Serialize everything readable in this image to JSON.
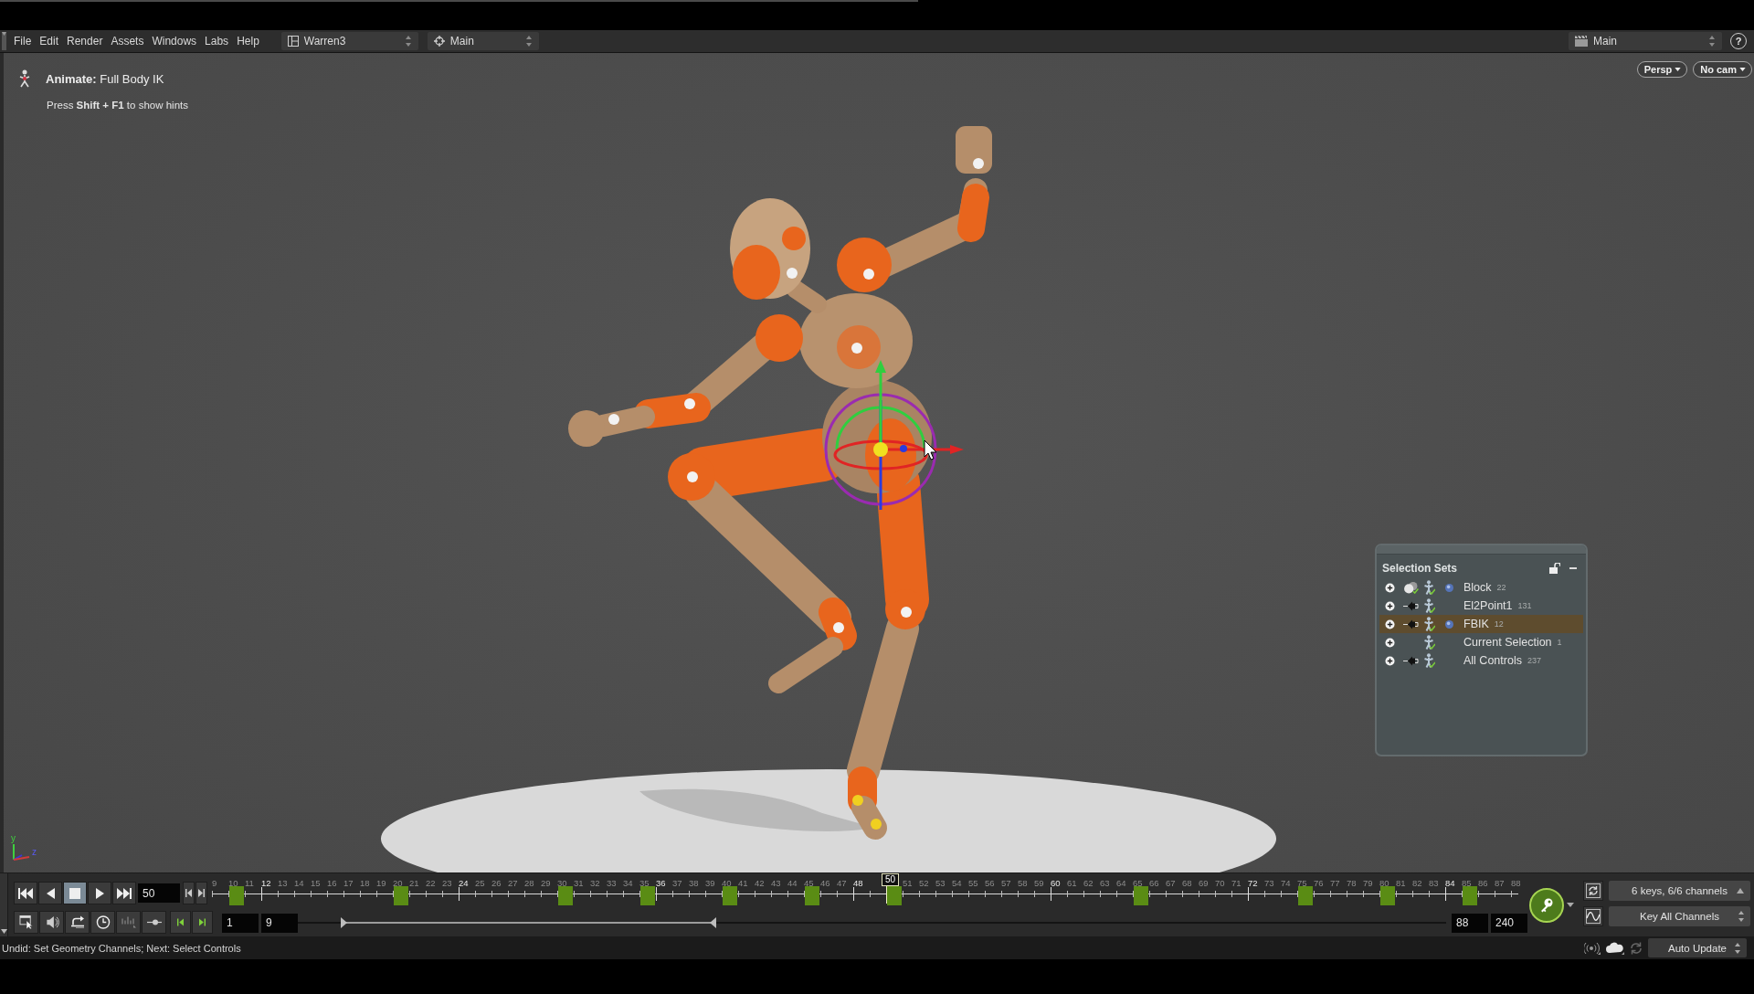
{
  "menubar": {
    "menus": [
      "File",
      "Edit",
      "Render",
      "Assets",
      "Windows",
      "Labs",
      "Help"
    ],
    "selectors": [
      {
        "kind": "layout",
        "label": "Warren3"
      },
      {
        "kind": "context",
        "label": "Main"
      }
    ],
    "take": {
      "label": "Main"
    },
    "help": "?"
  },
  "viewport": {
    "tool_title": "**Animate:** Full Body IK",
    "hint": "Press **Shift + F1** to show hints",
    "view_buttons": [
      "Persp",
      "No cam"
    ],
    "axis_labels": [
      "y",
      "z"
    ]
  },
  "selection_sets": {
    "title": "Selection Sets",
    "locked": false,
    "rows": [
      {
        "name": "Block",
        "count": "22",
        "kind": "geometry",
        "marked": true,
        "selected": false,
        "expanded": false
      },
      {
        "name": "El2Point1",
        "count": "131",
        "kind": "pinned",
        "marked": false,
        "selected": false,
        "expanded": false
      },
      {
        "name": "FBIK",
        "count": "12",
        "kind": "pinned",
        "marked": true,
        "selected": true,
        "expanded": false
      },
      {
        "name": "Current Selection",
        "count": "1",
        "kind": "selection",
        "marked": false,
        "selected": false,
        "expanded": false
      },
      {
        "name": "All Controls",
        "count": "237",
        "kind": "pinned",
        "marked": false,
        "selected": false,
        "expanded": false
      }
    ]
  },
  "timeline": {
    "play_buttons": [
      {
        "kind": "first",
        "selected": false
      },
      {
        "kind": "reverse",
        "selected": false
      },
      {
        "kind": "stop",
        "selected": true
      },
      {
        "kind": "play",
        "selected": false
      },
      {
        "kind": "last",
        "selected": false
      }
    ],
    "frame": "50",
    "frames": [
      {
        "label": "9",
        "major": false,
        "key": false,
        "selected": false
      },
      {
        "label": "10",
        "major": false,
        "key": true,
        "selected": false
      },
      {
        "label": "11",
        "major": false,
        "key": false,
        "selected": false
      },
      {
        "label": "12",
        "major": true,
        "key": false,
        "selected": false
      },
      {
        "label": "13",
        "major": false,
        "key": false,
        "selected": false
      },
      {
        "label": "14",
        "major": false,
        "key": false,
        "selected": false
      },
      {
        "label": "15",
        "major": false,
        "key": false,
        "selected": false
      },
      {
        "label": "16",
        "major": false,
        "key": false,
        "selected": false
      },
      {
        "label": "17",
        "major": false,
        "key": false,
        "selected": false
      },
      {
        "label": "18",
        "major": false,
        "key": false,
        "selected": false
      },
      {
        "label": "19",
        "major": false,
        "key": false,
        "selected": false
      },
      {
        "label": "20",
        "major": false,
        "key": true,
        "selected": false
      },
      {
        "label": "21",
        "major": false,
        "key": false,
        "selected": false
      },
      {
        "label": "22",
        "major": false,
        "key": false,
        "selected": false
      },
      {
        "label": "23",
        "major": false,
        "key": false,
        "selected": false
      },
      {
        "label": "24",
        "major": true,
        "key": false,
        "selected": false
      },
      {
        "label": "25",
        "major": false,
        "key": false,
        "selected": false
      },
      {
        "label": "26",
        "major": false,
        "key": false,
        "selected": false
      },
      {
        "label": "27",
        "major": false,
        "key": false,
        "selected": false
      },
      {
        "label": "28",
        "major": false,
        "key": false,
        "selected": false
      },
      {
        "label": "29",
        "major": false,
        "key": false,
        "selected": false
      },
      {
        "label": "30",
        "major": false,
        "key": true,
        "selected": false
      },
      {
        "label": "31",
        "major": false,
        "key": false,
        "selected": false
      },
      {
        "label": "32",
        "major": false,
        "key": false,
        "selected": false
      },
      {
        "label": "33",
        "major": false,
        "key": false,
        "selected": false
      },
      {
        "label": "34",
        "major": false,
        "key": false,
        "selected": false
      },
      {
        "label": "35",
        "major": false,
        "key": true,
        "selected": false
      },
      {
        "label": "36",
        "major": true,
        "key": false,
        "selected": false
      },
      {
        "label": "37",
        "major": false,
        "key": false,
        "selected": false
      },
      {
        "label": "38",
        "major": false,
        "key": false,
        "selected": false
      },
      {
        "label": "39",
        "major": false,
        "key": false,
        "selected": false
      },
      {
        "label": "40",
        "major": false,
        "key": true,
        "selected": false
      },
      {
        "label": "41",
        "major": false,
        "key": false,
        "selected": false
      },
      {
        "label": "42",
        "major": false,
        "key": false,
        "selected": false
      },
      {
        "label": "43",
        "major": false,
        "key": false,
        "selected": false
      },
      {
        "label": "44",
        "major": false,
        "key": false,
        "selected": false
      },
      {
        "label": "45",
        "major": false,
        "key": true,
        "selected": false
      },
      {
        "label": "46",
        "major": false,
        "key": false,
        "selected": false
      },
      {
        "label": "47",
        "major": false,
        "key": false,
        "selected": false
      },
      {
        "label": "48",
        "major": true,
        "key": false,
        "selected": false
      },
      {
        "major": false,
        "key": false,
        "selected": false
      },
      {
        "label": "50",
        "major": false,
        "key": true,
        "selected": true
      },
      {
        "label": "51",
        "major": false,
        "key": false,
        "selected": false
      },
      {
        "label": "52",
        "major": false,
        "key": false,
        "selected": false
      },
      {
        "label": "53",
        "major": false,
        "key": false,
        "selected": false
      },
      {
        "label": "54",
        "major": false,
        "key": false,
        "selected": false
      },
      {
        "label": "55",
        "major": false,
        "key": false,
        "selected": false
      },
      {
        "label": "56",
        "major": false,
        "key": false,
        "selected": false
      },
      {
        "label": "57",
        "major": false,
        "key": false,
        "selected": false
      },
      {
        "label": "58",
        "major": false,
        "key": false,
        "selected": false
      },
      {
        "label": "59",
        "major": false,
        "key": false,
        "selected": false
      },
      {
        "label": "60",
        "major": true,
        "key": false,
        "selected": false
      },
      {
        "label": "61",
        "major": false,
        "key": false,
        "selected": false
      },
      {
        "label": "62",
        "major": false,
        "key": false,
        "selected": false
      },
      {
        "label": "63",
        "major": false,
        "key": false,
        "selected": false
      },
      {
        "label": "64",
        "major": false,
        "key": false,
        "selected": false
      },
      {
        "label": "65",
        "major": false,
        "key": true,
        "selected": false
      },
      {
        "label": "66",
        "major": false,
        "key": false,
        "selected": false
      },
      {
        "label": "67",
        "major": false,
        "key": false,
        "selected": false
      },
      {
        "label": "68",
        "major": false,
        "key": false,
        "selected": false
      },
      {
        "label": "69",
        "major": false,
        "key": false,
        "selected": false
      },
      {
        "label": "70",
        "major": false,
        "key": false,
        "selected": false
      },
      {
        "label": "71",
        "major": false,
        "key": false,
        "selected": false
      },
      {
        "label": "72",
        "major": true,
        "key": false,
        "selected": false
      },
      {
        "label": "73",
        "major": false,
        "key": false,
        "selected": false
      },
      {
        "label": "74",
        "major": false,
        "key": false,
        "selected": false
      },
      {
        "label": "75",
        "major": false,
        "key": true,
        "selected": false
      },
      {
        "label": "76",
        "major": false,
        "key": false,
        "selected": false
      },
      {
        "label": "77",
        "major": false,
        "key": false,
        "selected": false
      },
      {
        "label": "78",
        "major": false,
        "key": false,
        "selected": false
      },
      {
        "label": "79",
        "major": false,
        "key": false,
        "selected": false
      },
      {
        "label": "80",
        "major": false,
        "key": true,
        "selected": false
      },
      {
        "label": "81",
        "major": false,
        "key": false,
        "selected": false
      },
      {
        "label": "82",
        "major": false,
        "key": false,
        "selected": false
      },
      {
        "label": "83",
        "major": false,
        "key": false,
        "selected": false
      },
      {
        "label": "84",
        "major": true,
        "key": false,
        "selected": false
      },
      {
        "label": "85",
        "major": false,
        "key": true,
        "selected": false
      },
      {
        "label": "86",
        "major": false,
        "key": false,
        "selected": false
      },
      {
        "label": "87",
        "major": false,
        "key": false,
        "selected": false
      },
      {
        "label": "88",
        "major": false,
        "key": false,
        "selected": false
      }
    ],
    "range": {
      "start": "1",
      "visible_start": "9",
      "visible_end": "88",
      "end": "240",
      "handles": [
        {
          "level": 0.037
        },
        {
          "level": 0.364
        }
      ]
    },
    "keys_summary": "6 keys, 6/6 channels",
    "key_mode": "Key All Channels"
  },
  "status_bar": {
    "message": "Undid: Set Geometry Channels; Next: Select Controls",
    "update_mode": "Auto Update"
  }
}
